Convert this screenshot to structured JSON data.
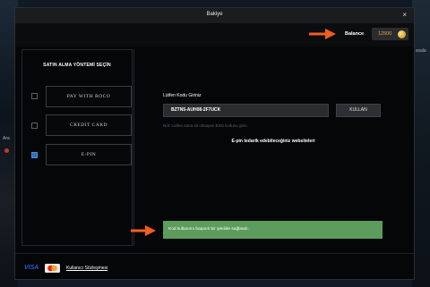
{
  "background": {
    "left_fragment": "Ara",
    "right_fragment": "ssala"
  },
  "window": {
    "title": "Bakiye",
    "close_glyph": "×"
  },
  "balance": {
    "label": "Balance",
    "value": "12500",
    "currency_icon": "coin-icon"
  },
  "payment_methods": {
    "heading": "SATIN ALMA YÖNTEMİ SEÇİN",
    "options": [
      {
        "label": "PAY WITH ROCO",
        "selected": false
      },
      {
        "label": "CREDIT CARD",
        "selected": false
      },
      {
        "label": "E-PIN",
        "selected": true
      }
    ]
  },
  "epin_form": {
    "field_label": "Lütfen Kodu Giriniz",
    "code_value": "BZTN5-AUH08-2F7UCK",
    "use_button": "KULLAN",
    "note": "Not: Lütfen sana ait olmayan ESN kodunu girin.",
    "link_text": "E-pin tedarik edebileceğiniz websiteleri"
  },
  "success_message": "Kod kullanımı başarılı bir şekilde sağlandı.",
  "footer": {
    "visa_label": "VISA",
    "terms_link": "Kullanıcı Sözleşmesi"
  },
  "colors": {
    "accent_arrow": "#f25d22",
    "success": "#5c9c5c",
    "balance_value": "#e8a93c"
  }
}
